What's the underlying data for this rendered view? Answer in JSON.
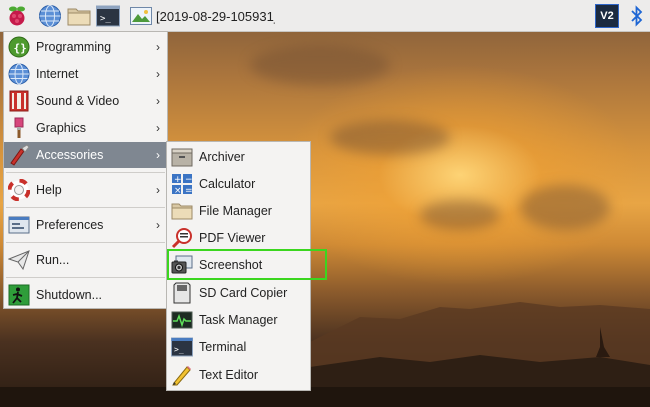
{
  "taskbar": {
    "window_title": "[2019-08-29-105931_..."
  },
  "tray": {
    "vnc_label": "V2"
  },
  "main_menu": {
    "items": [
      {
        "label": "Programming",
        "icon": "programming-icon",
        "has_submenu": true
      },
      {
        "label": "Internet",
        "icon": "globe-icon",
        "has_submenu": true
      },
      {
        "label": "Sound & Video",
        "icon": "sound-video-icon",
        "has_submenu": true
      },
      {
        "label": "Graphics",
        "icon": "paintbrush-icon",
        "has_submenu": true
      },
      {
        "label": "Accessories",
        "icon": "accessories-icon",
        "has_submenu": true,
        "active": true
      },
      {
        "label": "Help",
        "icon": "lifebuoy-icon",
        "has_submenu": true
      },
      {
        "label": "Preferences",
        "icon": "preferences-icon",
        "has_submenu": true
      },
      {
        "label": "Run...",
        "icon": "paper-plane-icon",
        "has_submenu": false
      },
      {
        "label": "Shutdown...",
        "icon": "exit-icon",
        "has_submenu": false
      }
    ],
    "arrow_glyph": "›"
  },
  "accessories_menu": {
    "items": [
      {
        "label": "Archiver",
        "icon": "archiver-icon"
      },
      {
        "label": "Calculator",
        "icon": "calculator-icon"
      },
      {
        "label": "File Manager",
        "icon": "folder-icon"
      },
      {
        "label": "PDF Viewer",
        "icon": "pdf-viewer-icon"
      },
      {
        "label": "Screenshot",
        "icon": "camera-icon",
        "highlighted": true
      },
      {
        "label": "SD Card Copier",
        "icon": "sd-card-icon"
      },
      {
        "label": "Task Manager",
        "icon": "task-manager-icon"
      },
      {
        "label": "Terminal",
        "icon": "terminal-icon"
      },
      {
        "label": "Text Editor",
        "icon": "text-editor-icon"
      }
    ]
  },
  "colors": {
    "active_item_bg": "#7f8791",
    "highlight_border": "#3bd61f",
    "panel_bg": "#edeceb"
  }
}
